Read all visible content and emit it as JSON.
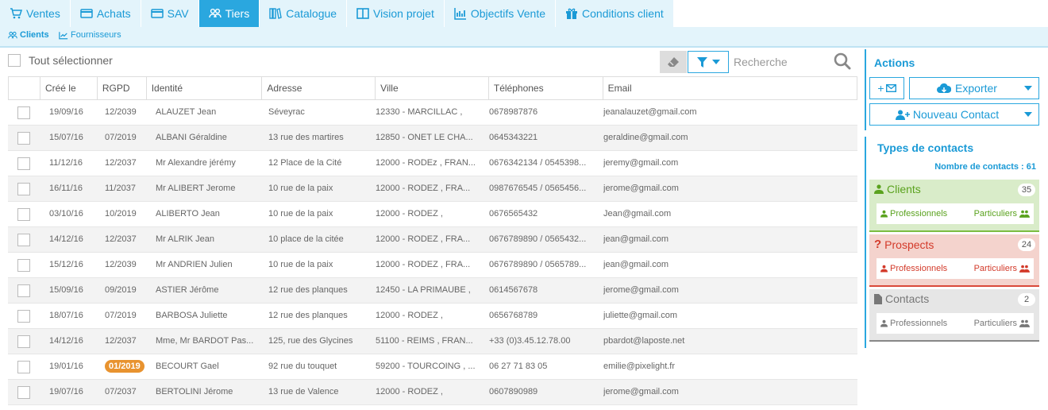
{
  "tabs": [
    {
      "label": "Ventes",
      "icon": "cart-icon",
      "active": false
    },
    {
      "label": "Achats",
      "icon": "credit-card-icon",
      "active": false
    },
    {
      "label": "SAV",
      "icon": "credit-card-icon",
      "active": false
    },
    {
      "label": "Tiers",
      "icon": "users-icon",
      "active": true
    },
    {
      "label": "Catalogue",
      "icon": "books-icon",
      "active": false
    },
    {
      "label": "Vision projet",
      "icon": "columns-icon",
      "active": false
    },
    {
      "label": "Objectifs Vente",
      "icon": "bar-chart-icon",
      "active": false
    },
    {
      "label": "Conditions client",
      "icon": "gift-icon",
      "active": false
    }
  ],
  "subtabs": [
    {
      "label": "Clients",
      "icon": "users-icon",
      "active": true
    },
    {
      "label": "Fournisseurs",
      "icon": "line-chart-icon",
      "active": false
    }
  ],
  "toolbar": {
    "select_all_label": "Tout sélectionner",
    "search_placeholder": "Recherche"
  },
  "table": {
    "headers": [
      "Créé le",
      "RGPD",
      "Identité",
      "Adresse",
      "Ville",
      "Téléphones",
      "Email"
    ],
    "rows": [
      {
        "created": "19/09/16",
        "rgpd": "12/2039",
        "identity": "ALAUZET Jean",
        "address": "Séveyrac",
        "city": "12330 - MARCILLAC ,",
        "phones": "0678987876",
        "email": "jeanalauzet@gmail.com"
      },
      {
        "created": "15/07/16",
        "rgpd": "07/2019",
        "identity": "ALBANI Géraldine",
        "address": "13 rue des martires",
        "city": "12850 - ONET LE CHA...",
        "phones": "0645343221",
        "email": "geraldine@gmail.com"
      },
      {
        "created": "11/12/16",
        "rgpd": "12/2037",
        "identity": "Mr Alexandre jérémy",
        "address": "12 Place de la Cité",
        "city": "12000 - RODEz , FRAN...",
        "phones": "0676342134 / 0545398...",
        "email": "jeremy@gmail.com"
      },
      {
        "created": "16/11/16",
        "rgpd": "11/2037",
        "identity": "Mr ALIBERT Jerome",
        "address": "10 rue de la paix",
        "city": "12000 - RODEZ , FRA...",
        "phones": "0987676545 / 0565456...",
        "email": "jerome@gmail.com"
      },
      {
        "created": "03/10/16",
        "rgpd": "10/2019",
        "identity": "ALIBERTO Jean",
        "address": "10 rue de la paix",
        "city": "12000 - RODEZ ,",
        "phones": "0676565432",
        "email": "Jean@gmail.com"
      },
      {
        "created": "14/12/16",
        "rgpd": "12/2037",
        "identity": "Mr ALRIK Jean",
        "address": "10 place de la citée",
        "city": "12000 - RODEZ , FRA...",
        "phones": "0676789890 / 0565432...",
        "email": "jean@gmail.com"
      },
      {
        "created": "15/12/16",
        "rgpd": "12/2039",
        "identity": "Mr ANDRIEN Julien",
        "address": "10 rue de la paix",
        "city": "12000 - RODEZ , FRA...",
        "phones": "0676789890 / 0565789...",
        "email": "jean@gmail.com"
      },
      {
        "created": "15/09/16",
        "rgpd": "09/2019",
        "identity": "ASTIER Jérôme",
        "address": "12 rue des planques",
        "city": "12450 - LA PRIMAUBE ,",
        "phones": "0614567678",
        "email": "jerome@gmail.com"
      },
      {
        "created": "18/07/16",
        "rgpd": "07/2019",
        "identity": "BARBOSA Juliette",
        "address": "12 rue des planques",
        "city": "12000 - RODEZ ,",
        "phones": "0656768789",
        "email": "juliette@gmail.com"
      },
      {
        "created": "14/12/16",
        "rgpd": "12/2037",
        "identity": "Mme, Mr BARDOT Pas...",
        "address": "125, rue des Glycines",
        "city": "51100 - REIMS , FRAN...",
        "phones": "+33 (0)3.45.12.78.00",
        "email": "pbardot@laposte.net"
      },
      {
        "created": "19/01/16",
        "rgpd": "01/2019",
        "rgpd_warning": true,
        "identity": "BECOURT Gael",
        "address": "92 rue du touquet",
        "city": "59200 - TOURCOING , ...",
        "phones": "06 27 71 83 05",
        "email": "emilie@pixelight.fr"
      },
      {
        "created": "19/07/16",
        "rgpd": "07/2037",
        "identity": "BERTOLINI Jérome",
        "address": "13 rue de Valence",
        "city": "12000 - RODEZ ,",
        "phones": "0607890989",
        "email": "jerome@gmail.com"
      }
    ]
  },
  "actions": {
    "title": "Actions",
    "email_button": "+",
    "export_label": "Exporter",
    "new_contact_label": "Nouveau Contact"
  },
  "types": {
    "title": "Types de contacts",
    "count_label": "Nombre de contacts : 61",
    "cards": [
      {
        "label": "Clients",
        "count": "35",
        "icon": "user-icon",
        "pro": "Professionnels",
        "part": "Particuliers",
        "bg": "#d9ecc9",
        "border": "#7cbd42",
        "fg": "#5aa21e"
      },
      {
        "label": "Prospects",
        "count": "24",
        "icon": "question-icon",
        "pro": "Professionnels",
        "part": "Particuliers",
        "bg": "#f4d3cd",
        "border": "#d9493a",
        "fg": "#d33a2a"
      },
      {
        "label": "Contacts",
        "count": "2",
        "icon": "file-icon",
        "pro": "Professionnels",
        "part": "Particuliers",
        "bg": "#e6e6e6",
        "border": "#888888",
        "fg": "#777777"
      }
    ]
  },
  "colors": {
    "accent": "#2aa7df",
    "accent_light": "#e3f4fb",
    "warning": "#e8932f"
  }
}
